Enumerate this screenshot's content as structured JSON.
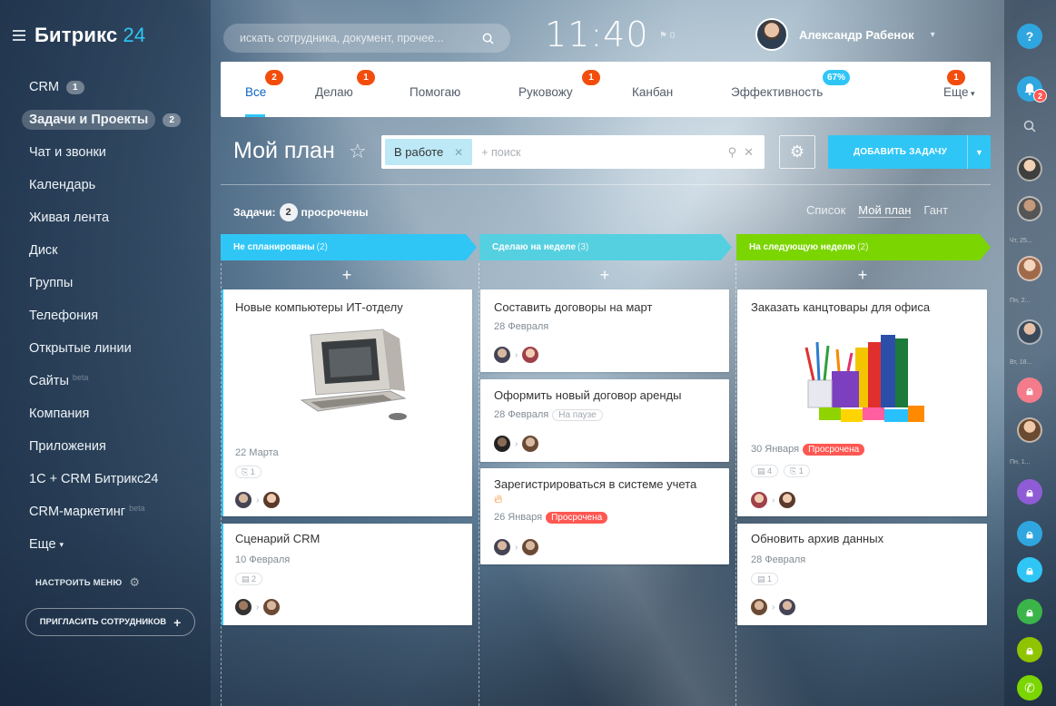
{
  "brand": {
    "name": "Битрикс",
    "num": "24"
  },
  "sidebar": {
    "items": [
      {
        "label": "CRM",
        "count": "1"
      },
      {
        "label": "Задачи и Проекты",
        "count": "2"
      },
      {
        "label": "Чат и звонки"
      },
      {
        "label": "Календарь"
      },
      {
        "label": "Живая лента"
      },
      {
        "label": "Диск"
      },
      {
        "label": "Группы"
      },
      {
        "label": "Телефония"
      },
      {
        "label": "Открытые линии"
      },
      {
        "label": "Сайты",
        "beta": "beta"
      },
      {
        "label": "Компания"
      },
      {
        "label": "Приложения"
      },
      {
        "label": "1С + CRM Битрикс24"
      },
      {
        "label": "CRM-маркетинг",
        "beta": "beta"
      },
      {
        "label": "Еще"
      }
    ],
    "configure": "НАСТРОИТЬ МЕНЮ",
    "invite": "ПРИГЛАСИТЬ СОТРУДНИКОВ"
  },
  "header": {
    "search_placeholder": "искать сотрудника, документ, прочее...",
    "time": "11:40",
    "flag_count": "0",
    "user_name": "Александр Рабенок"
  },
  "tabs": [
    {
      "label": "Все",
      "badge": "2"
    },
    {
      "label": "Делаю",
      "badge": "1"
    },
    {
      "label": "Помогаю"
    },
    {
      "label": "Руковожу",
      "badge": "1"
    },
    {
      "label": "Канбан"
    },
    {
      "label": "Эффективность",
      "badge": "67%"
    },
    {
      "label": "Еще",
      "badge": "1"
    }
  ],
  "toolbar": {
    "title": "Мой план",
    "filter_chip": "В работе",
    "filter_placeholder": "+ поиск",
    "add_task": "ДОБАВИТЬ ЗАДАЧУ"
  },
  "summary": {
    "prefix": "Задачи:",
    "count": "2",
    "suffix": "просрочены"
  },
  "views": {
    "list": "Список",
    "plan": "Мой план",
    "gantt": "Гант"
  },
  "columns": [
    {
      "title": "Не спланированы",
      "count": "(2)",
      "color": "#2fc6f6"
    },
    {
      "title": "Сделаю на неделе",
      "count": "(3)",
      "color": "#55d0e0"
    },
    {
      "title": "На следующую неделю",
      "count": "(2)",
      "color": "#7bd500"
    }
  ],
  "cards": {
    "c1": {
      "title": "Новые компьютеры ИТ-отделу",
      "date": "22 Марта",
      "files": "1"
    },
    "c2": {
      "title": "Сценарий CRM",
      "date": "10 Февраля",
      "files": "2"
    },
    "c3": {
      "title": "Составить договоры на март",
      "date": "28 Февраля"
    },
    "c4": {
      "title": "Оформить новый договор аренды",
      "date": "28 Февраля",
      "tag": "На паузе"
    },
    "c5": {
      "title": "Зарегистрироваться в системе учета",
      "date": "26 Января",
      "tag": "Просрочена"
    },
    "c6": {
      "title": "Заказать канцтовары для офиса",
      "date": "30 Января",
      "tag": "Просрочена",
      "comments": "4",
      "files": "1"
    },
    "c7": {
      "title": "Обновить архив данных",
      "date": "28 Февраля",
      "files": "1"
    }
  },
  "rpanel": {
    "help": "?",
    "notif_count": "2",
    "labels": [
      "Чт, 25...",
      "Пн, 2...",
      "Вт, 18...",
      "Пн, 1..."
    ]
  },
  "colors": {
    "accent": "#2fc6f6",
    "danger": "#ff5752",
    "badge": "#f34d0d",
    "green": "#7bd500"
  }
}
